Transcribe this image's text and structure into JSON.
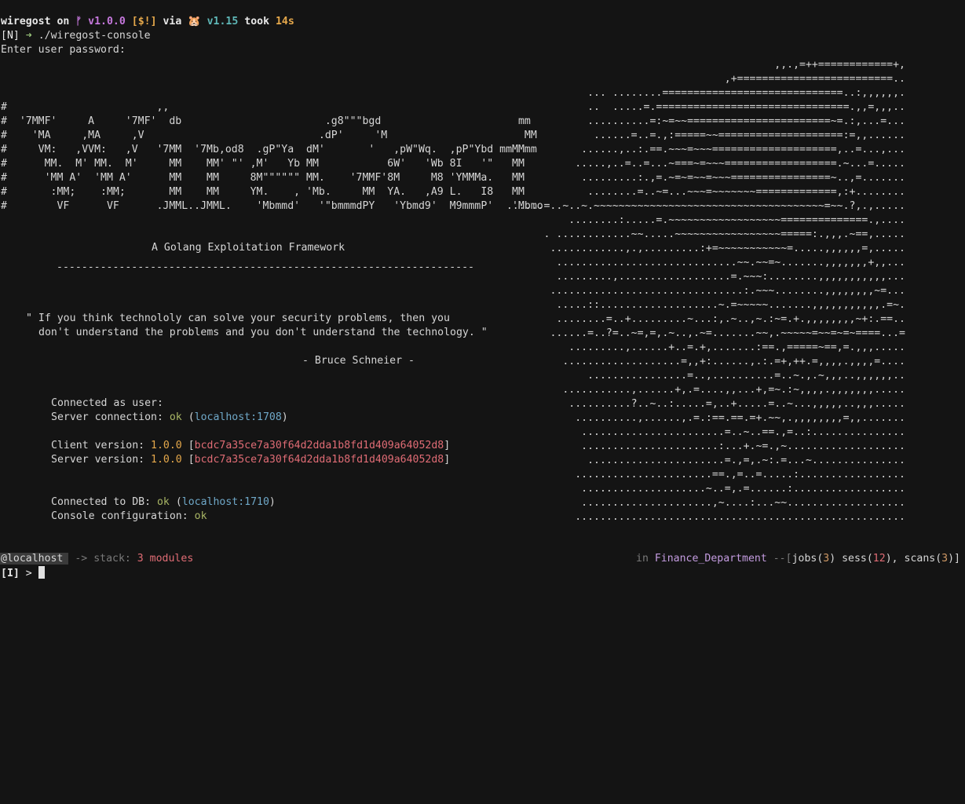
{
  "shell": {
    "user": "wiregost",
    "on": " on ",
    "branch_icon": "ᚠ",
    "version": "v1.0.0",
    "git_status": "[$!]",
    "via": " via ",
    "go_icon": "🐹",
    "go_version": "v1.15",
    "took": " took ",
    "duration": "14s",
    "prompt_mode": "[N]",
    "arrow": "➜",
    "command": "./wiregost-console",
    "password_prompt": "Enter user password:"
  },
  "logo_lines": [
    "#                        ,,",
    "#  '7MMF'     A     '7MF'  db                       .g8\"\"\"bgd                      mm",
    "#    'MA     ,MA     ,V                            .dP'     'M                      MM",
    "#     VM:   ,VVM:   ,V   '7MM  '7Mb,od8  .gP\"Ya  dM'       '   ,pW\"Wq.  ,pP\"Ybd mmMMmm",
    "#      MM.  M' MM.  M'     MM    MM' \"' ,M'   Yb MM           6W'   'Wb 8I   '\"   MM",
    "#      'MM A'  'MM A'      MM    MM     8M\"\"\"\"\"\" MM.    '7MMF'8M     M8 'YMMMa.   MM",
    "#       :MM;    :MM;       MM    MM     YM.    , 'Mb.     MM  YA.   ,A9 L.   I8   MM",
    "#        VF      VF      .JMML..JMML.    'Mbmmd'   '\"bmmmdPY   'Ybmd9'  M9mmmP'   'Mbmo"
  ],
  "art_lines": [
    ",,.,=++============+,",
    ",+=========================..",
    "... ........=============================..:,,,,,,.",
    "..  .....=.===============================.,,=,,,..",
    "..........=:~=~~=======================~=.:,...=...",
    "......=..=.,:=====~~====================:=,,......",
    "......,..:.==.~~~=~~~====================,..=...,...",
    ".....,..=..=...~===~=~~~==================.~...=.....",
    ".........:.,=.~=~=~~=~~~================~..,=.......",
    "........=..~=...~~~=~~~~~~~=============,:+........",
    "......=..~..~.~~~~~~~~~~~~~~~~~~~~~~~~~~~~~~~~~~~~~=~~.?,.,.....",
    "........:.....=.~~~~~~~~~~~~~~~~~~==============.,....",
    ". ............~~.....~~~~~~~~~~~~~~~~~=====:.,,,.~==,.....",
    "............,.,.........:+=~~~~~~~~~~~=.....,,,,,,=,.....",
    ".............................~~.~~=~.......,,,,,,,+,,...",
    ".........,..................=.~~~:........,,,,,,,,,,,...",
    "...............................:.~~~........,,,,,,,,~=...",
    ".....::...................~.=~~~~~.......,,,,,,,,,,,.=~.",
    "........=..+.........~...:,.~..,~.:~=.+.,,,,,,,,~+:.==..",
    "......=..?=..~=,=,.~..,.~=.......~~,.~~~~~=~~=~=~====...=",
    ".........,......+..=.+,.......:==.,=====~==,=.,,,.....",
    "...................=,,+:......,.:.=+,++.=,,,,.,,,,=....",
    "................=..,..........=..~.,.~,,,..,,,,,,..",
    "...........,......+,.=....,,...+,=~.:~,,,,.,,,,,,,.....",
    "..........?..~..:.....=,..+.....=..~...,,,,,..,,,.....",
    "..........,......,.=.:==.==.=+.~~,.,,,,,,,,=,,.......",
    ".......................=..~..==.,=..:...............",
    "......................:...+.~=.,~...................",
    "......................=.,=,.~:.=...~...............",
    "......................==.,=..=.....:.................",
    "....................~..=,.=......:..................",
    ".....................,~....:...~~...................",
    "....................................................."
  ],
  "banner": {
    "subtitle": "A Golang Exploitation Framework",
    "rule": "--------------------------------------------------------------------------",
    "quote_line1": "\" If you think technololy can solve your security problems, then you",
    "quote_line2": "don't understand the problems and you don't understand the technology. \"",
    "quote_author": "- Bruce Schneier -"
  },
  "info": {
    "connected_as": "Connected as user:",
    "server_connection_label": "Server connection: ",
    "server_connection_status": "ok",
    "server_host": "localhost:1708",
    "client_version_label": "Client version: ",
    "client_version": "1.0.0",
    "client_hash": "bcdc7a35ce7a30f64d2dda1b8fd1d409a64052d8",
    "server_version_label": "Server version: ",
    "server_version": "1.0.0",
    "server_hash": "bcdc7a35ce7a30f64d2dda1b8fd1d409a64052d8",
    "db_label": "Connected to DB: ",
    "db_status": "ok",
    "db_host": "localhost:1710",
    "console_config_label": "Console configuration: ",
    "console_config_status": "ok"
  },
  "status": {
    "host": "@localhost",
    "stack_arrow": "->",
    "stack_label": "stack:",
    "stack_count": "3 modules",
    "in_label": "in",
    "workspace": "Finance_Department",
    "dashes": "--[",
    "jobs_label": "jobs(",
    "jobs_count": "3",
    "sess_label": ") sess(",
    "sess_count": "12",
    "scans_label": "), scans(",
    "scans_count": "3",
    "close": ")]"
  },
  "prompt": {
    "mode": "[I]",
    "symbol": ">"
  }
}
